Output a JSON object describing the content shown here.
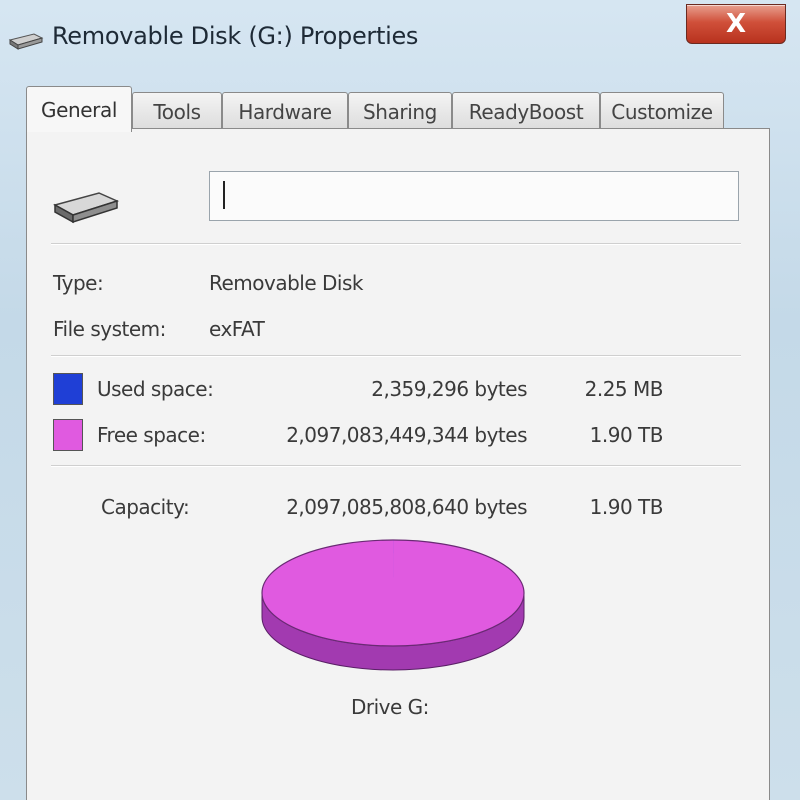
{
  "window": {
    "title": "Removable Disk (G:) Properties",
    "close_label": "X"
  },
  "tabs": [
    {
      "label": "General",
      "active": true
    },
    {
      "label": "Tools",
      "active": false
    },
    {
      "label": "Hardware",
      "active": false
    },
    {
      "label": "Sharing",
      "active": false
    },
    {
      "label": "ReadyBoost",
      "active": false
    },
    {
      "label": "Customize",
      "active": false
    }
  ],
  "general": {
    "drive_icon": "removable-drive-icon",
    "name_value": "",
    "type_label": "Type:",
    "type_value": "Removable Disk",
    "fs_label": "File system:",
    "fs_value": "exFAT",
    "used": {
      "label": "Used space:",
      "bytes": "2,359,296 bytes",
      "size": "2.25 MB",
      "color": "#1f3fd6"
    },
    "free": {
      "label": "Free space:",
      "bytes": "2,097,083,449,344 bytes",
      "size": "1.90 TB",
      "color": "#e05ae0"
    },
    "capacity": {
      "label": "Capacity:",
      "bytes": "2,097,085,808,640 bytes",
      "size": "1.90 TB"
    },
    "drive_label": "Drive G:",
    "used_fraction": 1.1e-06
  }
}
